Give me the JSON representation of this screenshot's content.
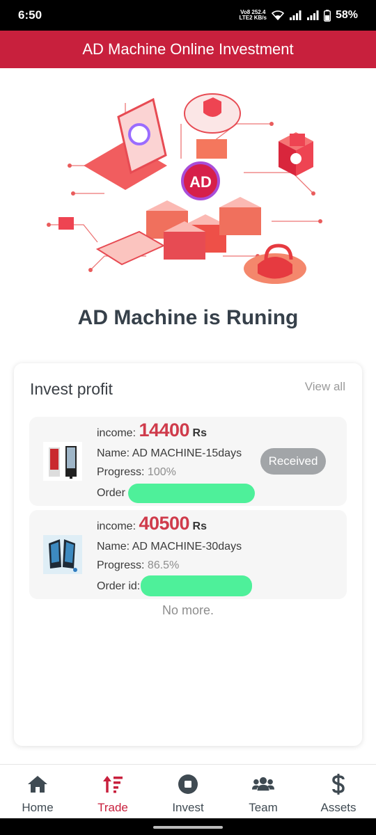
{
  "status_bar": {
    "time": "6:50",
    "network_top": "Vo8 252.4",
    "network_bottom": "LTE2  KB/s",
    "battery": "58%"
  },
  "header": {
    "title": "AD Machine Online Investment"
  },
  "hero": {
    "badge": "AD",
    "title": "AD Machine is Runing"
  },
  "invest": {
    "title": "Invest profit",
    "view_all": "View all",
    "items": [
      {
        "income_label": "income:",
        "income_value": "14400",
        "income_unit": "Rs",
        "name": "Name: AD MACHINE-15days",
        "progress_label": "Progress:",
        "progress_value": "100%",
        "order_label": "Order",
        "status": "Received"
      },
      {
        "income_label": "income:",
        "income_value": "40500",
        "income_unit": "Rs",
        "name": "Name: AD MACHINE-30days",
        "progress_label": "Progress:",
        "progress_value": "86.5%",
        "order_label": "Order id:"
      }
    ],
    "no_more": "No more."
  },
  "nav": {
    "items": [
      {
        "label": "Home",
        "icon": "home-icon"
      },
      {
        "label": "Trade",
        "icon": "sort-arrow-icon"
      },
      {
        "label": "Invest",
        "icon": "stop-circle-icon"
      },
      {
        "label": "Team",
        "icon": "users-icon"
      },
      {
        "label": "Assets",
        "icon": "dollar-icon"
      }
    ],
    "active": "Trade"
  },
  "colors": {
    "brand": "#c8203d",
    "income": "#cf3b4b",
    "redaction": "#4ef09a"
  }
}
